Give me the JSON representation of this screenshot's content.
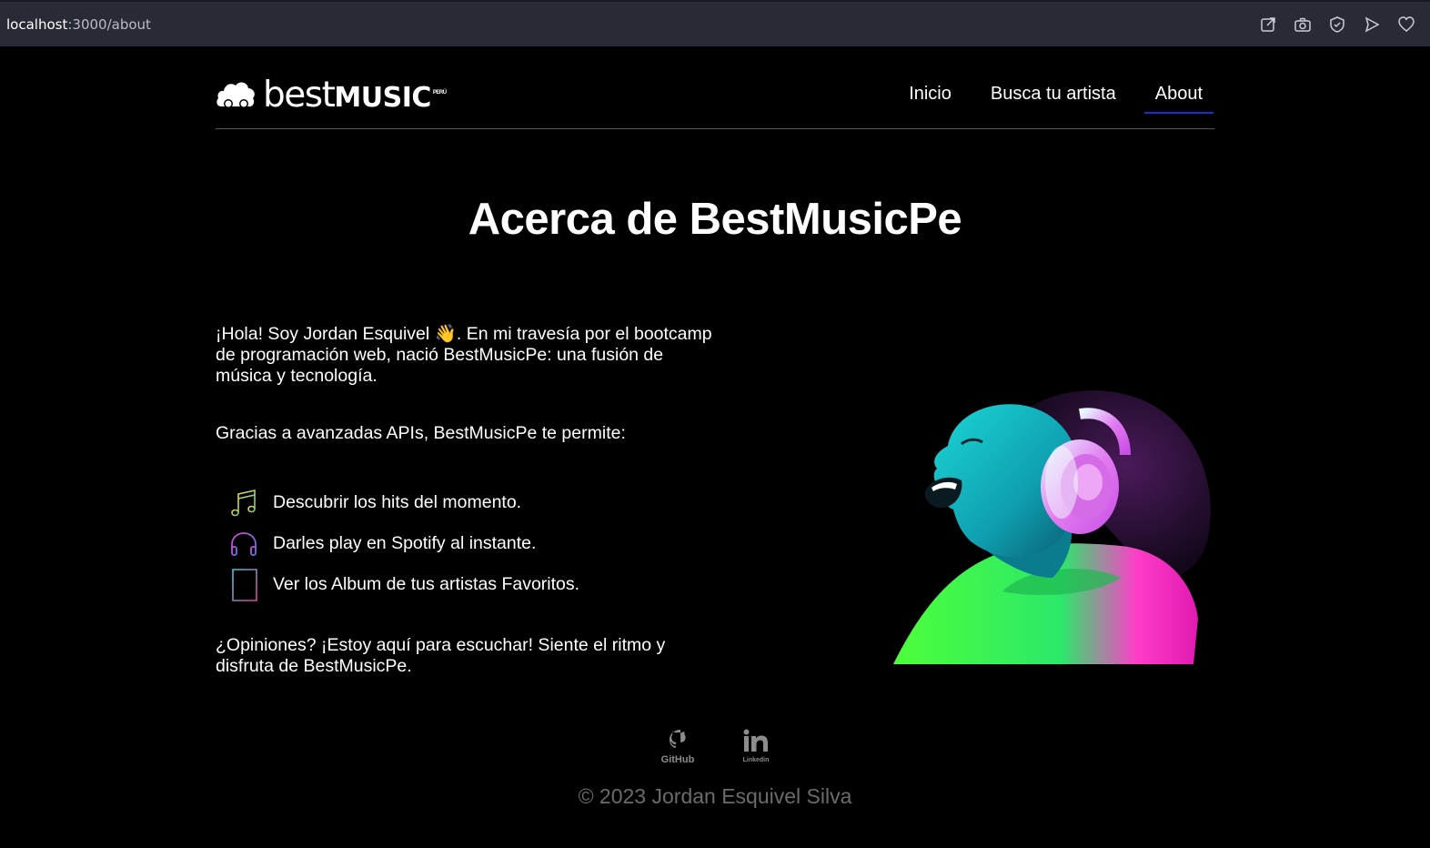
{
  "browser": {
    "url_host": "localhost",
    "url_path": ":3000/about",
    "icons": [
      "share-icon",
      "camera-icon",
      "shield-icon",
      "send-icon",
      "heart-icon"
    ]
  },
  "header": {
    "logo_part1": "best",
    "logo_part2": "MUSIC",
    "logo_sup": "PERÚ",
    "nav": {
      "inicio": "Inicio",
      "busca": "Busca tu artista",
      "about": "About"
    },
    "active_color": "#1a2bd8"
  },
  "main": {
    "title": "Acerca de BestMusicPe",
    "intro": "¡Hola! Soy Jordan Esquivel 👋. En mi travesía por el bootcamp de programación web, nació BestMusicPe: una fusión de música y tecnología.",
    "apis": "Gracias a avanzadas APIs, BestMusicPe te permite:",
    "features": [
      {
        "icon": "music-note-icon",
        "text": "Descubrir los hits del momento."
      },
      {
        "icon": "headphones-icon",
        "text": "Darles play en Spotify al instante."
      },
      {
        "icon": "album-icon",
        "text": "Ver los Album de tus artistas Favoritos."
      }
    ],
    "closing": "¿Opiniones? ¡Estoy aquí para escuchar! Siente el ritmo y disfruta de BestMusicPe."
  },
  "footer": {
    "github_label": "GitHub",
    "linkedin_label": "Linkedin",
    "copyright": "© 2023 Jordan Esquivel Silva"
  }
}
